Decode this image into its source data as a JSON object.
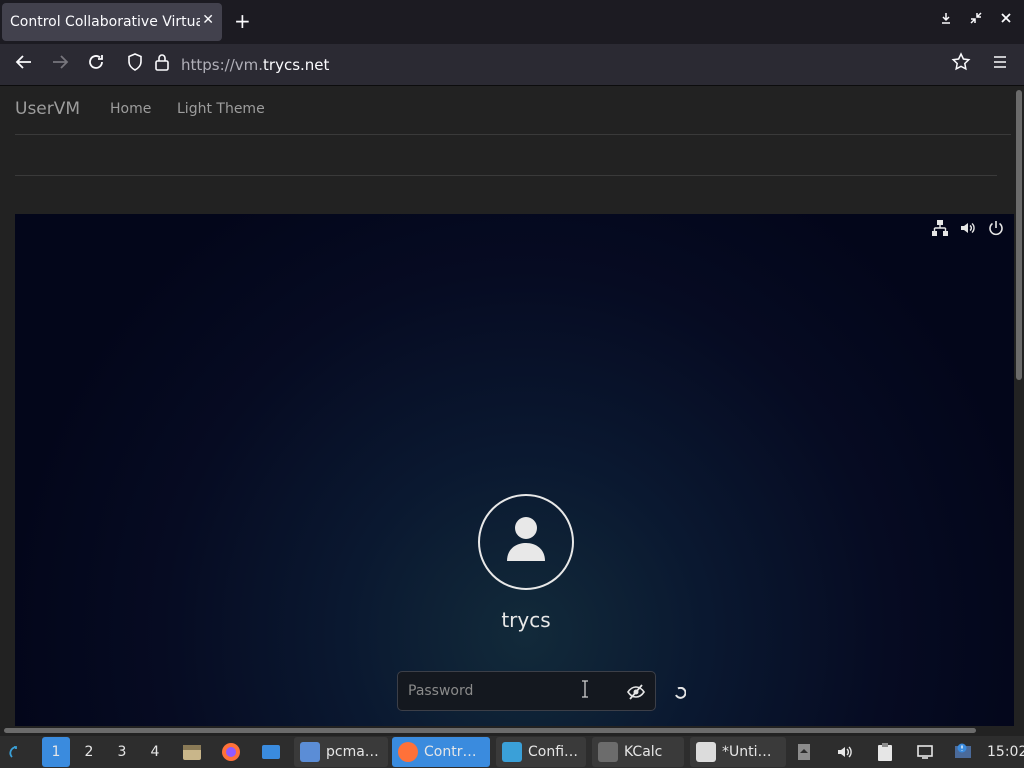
{
  "browser": {
    "tab_title": "Control Collaborative Virtual",
    "tab_close": "✕",
    "new_tab": "+",
    "url_prefix": "https://vm.",
    "url_domain": "trycs.net"
  },
  "page": {
    "brand": "UserVM",
    "nav": [
      "Home",
      "Light Theme"
    ]
  },
  "vm": {
    "username": "trycs",
    "password_placeholder": "Password"
  },
  "taskbar": {
    "workspaces": [
      "1",
      "2",
      "3",
      "4"
    ],
    "active_workspace": "1",
    "tasks": [
      {
        "label": "pcma…",
        "icon": "file-manager-icon",
        "color": "#5b8dd6"
      },
      {
        "label": "Contr…",
        "icon": "firefox-icon",
        "color": "#ff7139"
      },
      {
        "label": "Confi…",
        "icon": "settings-app-icon",
        "color": "#3aa0d8"
      },
      {
        "label": "KCalc",
        "icon": "calculator-icon",
        "color": "#6c6c6c"
      },
      {
        "label": "*Unti…",
        "icon": "text-editor-icon",
        "color": "#dcdcdc"
      }
    ],
    "clock": "15:02"
  },
  "colors": {
    "accent": "#3a8bde",
    "chrome_bg": "#1c1b22",
    "page_bg": "#222222"
  }
}
